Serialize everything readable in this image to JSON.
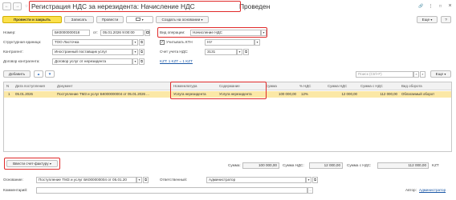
{
  "header": {
    "title": "Регистрация НДС за нерезидента: Начисление НДС",
    "status": "Проведен",
    "nav_back": "←",
    "nav_forward": "→",
    "star": "☆",
    "link_icon": "🔗",
    "more_icon": "⋮",
    "close_icon": "×",
    "maximize_icon": "□"
  },
  "toolbar": {
    "post_close": "Провести и закрыть",
    "save": "Записать",
    "post": "Провести",
    "create_based": "Создать на основании",
    "more": "Еще",
    "help": "?"
  },
  "form": {
    "number_label": "Номер:",
    "number_value": "БК0000000018",
    "date_from_label": "от:",
    "date_value": "05.01.2026 9:00:00",
    "operation_label": "Вид операции:",
    "operation_value": "Начисление НДС",
    "unit_label": "Структурная единица:",
    "unit_value": "ТОО Ласточка",
    "ktn_label": "Учитывать КТН",
    "ktn_value": "НУ",
    "counterparty_label": "Контрагент:",
    "counterparty_value": "Иностранный поставщик услуг",
    "account_label": "Счет учета НДС:",
    "account_value": "3131",
    "contract_label": "Договор контрагента:",
    "contract_value": "Договор услуг от нерезидента",
    "kzt_link": "KZT: 1 KZT = 1 KZT"
  },
  "table_toolbar": {
    "add": "Добавить",
    "search_placeholder": "Поиск (Ctrl+F)",
    "more": "Еще"
  },
  "table": {
    "columns": [
      "N",
      "Дата поступления",
      "Документ",
      "Номенклатура",
      "Содержание",
      "Сумма",
      "% НДС",
      "Сумма НДС",
      "Сумма с НДС",
      "Вид оборота"
    ],
    "rows": [
      [
        "1",
        "05.01.2026",
        "Поступление ТМЗ и услуг БК000000004 от 05.01.2026 ...",
        "Услуга нерезидента",
        "Услуга нерезидента",
        "100 000,00",
        "12%",
        "12 000,00",
        "112 000,00",
        "Облагаемый оборот"
      ]
    ]
  },
  "footer": {
    "invoice_button": "Ввести счет-фактуру",
    "sum_label": "Сумма:",
    "sum_value": "100 000,00",
    "vat_label": "Сумма НДС:",
    "vat_value": "12 000,00",
    "total_label": "Сумма с НДС:",
    "total_value": "112 000,00",
    "currency": "KZT",
    "basis_label": "Основание:",
    "basis_value": "Поступление ТМЗ и услуг БК000000004 от 05.01.20",
    "responsible_label": "Ответственный:",
    "responsible_value": "Администратор",
    "comment_label": "Комментарий:",
    "comment_value": "",
    "author_label": "Автор:",
    "author_value": "Администратор"
  },
  "colors": {
    "accent_yellow": "#fbe04c",
    "highlight_red": "#e02a2a",
    "selected_row": "#fbe8a6",
    "link_blue": "#1a57a6"
  }
}
